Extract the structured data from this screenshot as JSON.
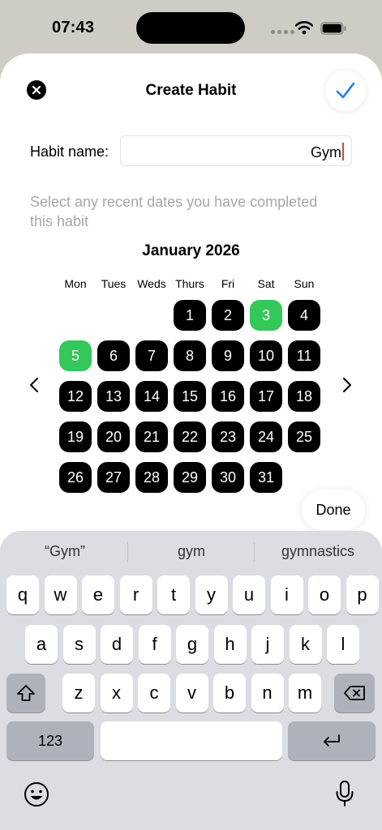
{
  "status": {
    "time": "07:43"
  },
  "sheet": {
    "title": "Create Habit",
    "habit_label": "Habit name:",
    "habit_value": "Gym",
    "hint": "Select any recent dates you have completed this habit"
  },
  "calendar": {
    "month": "January 2026",
    "weekdays": [
      "Mon",
      "Tues",
      "Weds",
      "Thurs",
      "Fri",
      "Sat",
      "Sun"
    ],
    "first_weekday_index": 3,
    "days_in_month": 31,
    "completed_days": [
      3,
      5
    ]
  },
  "accessory": {
    "done_label": "Done"
  },
  "keyboard": {
    "suggestions": [
      "“Gym”",
      "gym",
      "gymnastics"
    ],
    "row1": [
      "q",
      "w",
      "e",
      "r",
      "t",
      "y",
      "u",
      "i",
      "o",
      "p"
    ],
    "row2": [
      "a",
      "s",
      "d",
      "f",
      "g",
      "h",
      "j",
      "k",
      "l"
    ],
    "row3": [
      "z",
      "x",
      "c",
      "v",
      "b",
      "n",
      "m"
    ],
    "numbers_label": "123"
  },
  "colors": {
    "accent": "#1a82f0",
    "completed": "#34c759",
    "day": "#000000"
  }
}
